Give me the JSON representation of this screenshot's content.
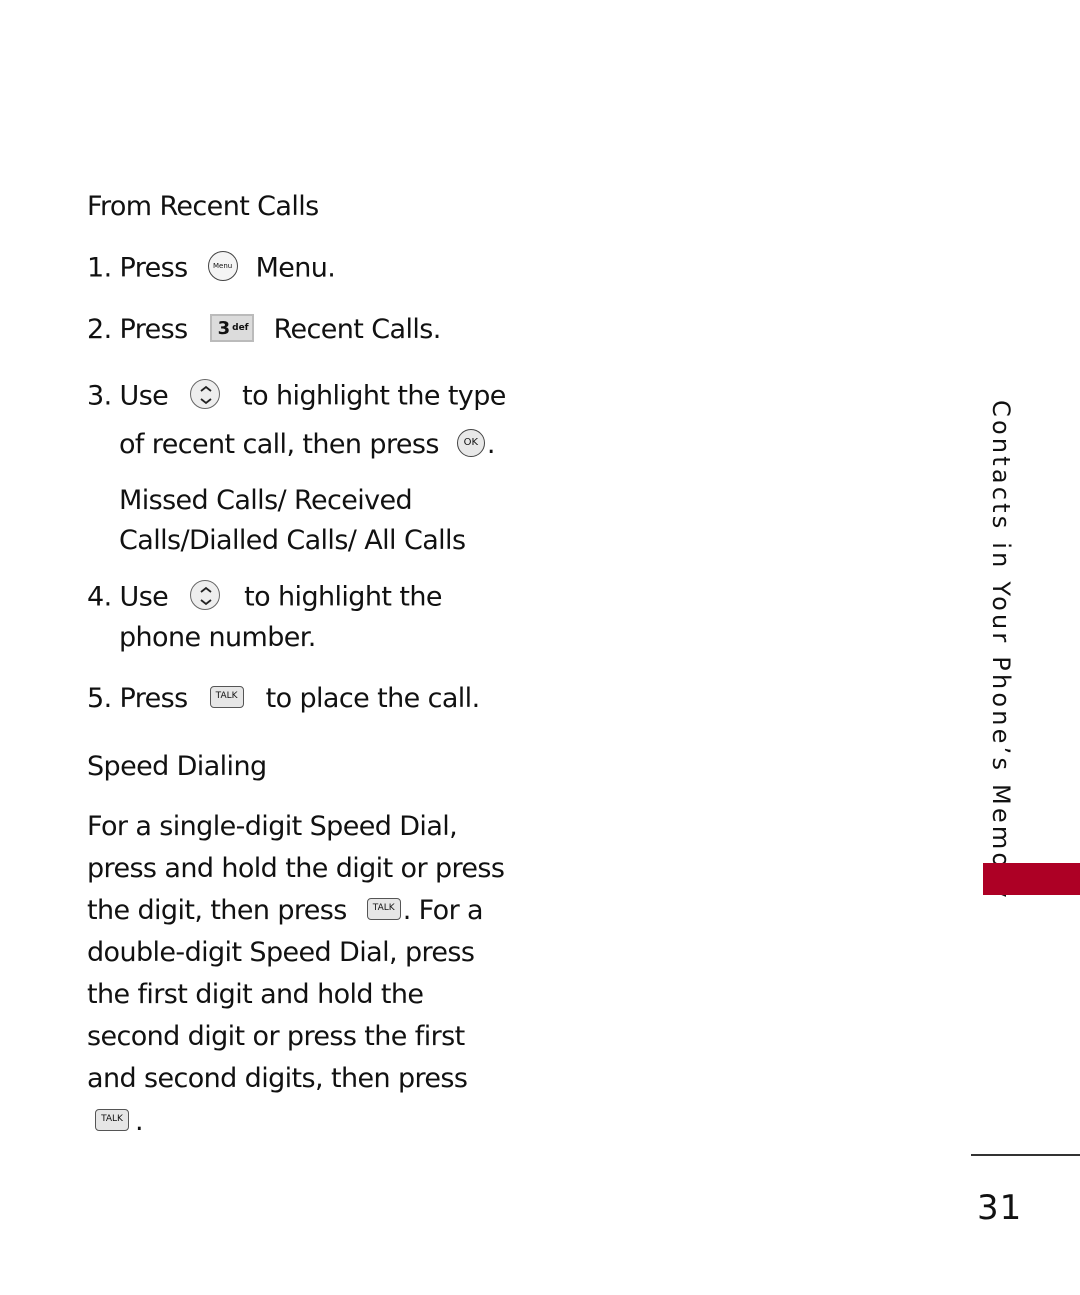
{
  "sections": {
    "recent_calls": {
      "heading": "From Recent Calls",
      "steps": [
        {
          "num": "1.",
          "pre": "Press",
          "icon": "menu-key-icon",
          "icon_label": "Menu",
          "post": "Menu."
        },
        {
          "num": "2.",
          "pre": "Press",
          "icon": "key-3-def-icon",
          "icon_label": "3",
          "icon_sub": "def",
          "post": "Recent Calls."
        },
        {
          "num": "3.",
          "pre": "Use",
          "icon": "navigation-up-down-icon",
          "post": "to highlight the type",
          "line2_pre": "of recent call, then press",
          "line2_icon": "ok-key-icon",
          "line2_icon_label": "OK",
          "line2_post": ".",
          "options_line1": "Missed Calls/ Received",
          "options_line2": "Calls/Dialled Calls/ All Calls"
        },
        {
          "num": "4.",
          "pre": "Use",
          "icon": "navigation-up-down-icon",
          "post": "to highlight the",
          "line2": "phone number."
        },
        {
          "num": "5.",
          "pre": "Press",
          "icon": "talk-key-icon",
          "icon_label": "TALK",
          "post": "to place the call."
        }
      ]
    },
    "speed_dialing": {
      "heading": "Speed Dialing",
      "lines": [
        "For a single-digit Speed Dial,",
        "press and hold the digit or press",
        "the digit, then press",
        ". For a",
        "double-digit Speed Dial, press",
        "the first digit and hold the",
        "second digit or press the first",
        "and second digits, then press",
        "."
      ],
      "talk_label": "TALK"
    }
  },
  "sidebar": {
    "chapter_title": "Contacts in Your Phone’s Memory",
    "accent_color": "#ad0025"
  },
  "page_number": "31"
}
